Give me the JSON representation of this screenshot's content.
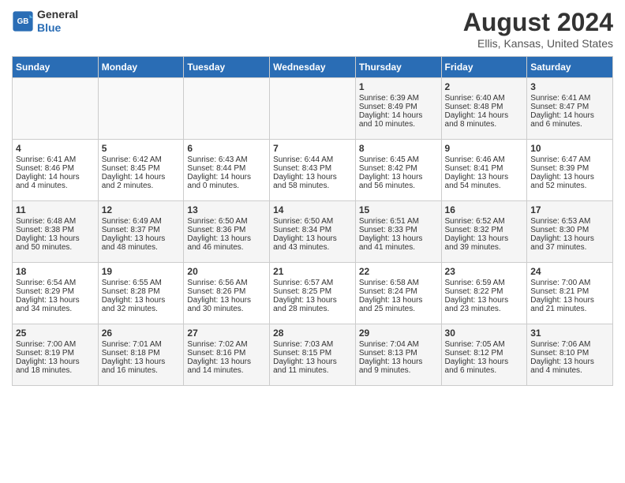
{
  "header": {
    "logo_line1": "General",
    "logo_line2": "Blue",
    "month": "August 2024",
    "location": "Ellis, Kansas, United States"
  },
  "days_of_week": [
    "Sunday",
    "Monday",
    "Tuesday",
    "Wednesday",
    "Thursday",
    "Friday",
    "Saturday"
  ],
  "weeks": [
    [
      {
        "day": "",
        "sunrise": "",
        "sunset": "",
        "daylight": ""
      },
      {
        "day": "",
        "sunrise": "",
        "sunset": "",
        "daylight": ""
      },
      {
        "day": "",
        "sunrise": "",
        "sunset": "",
        "daylight": ""
      },
      {
        "day": "",
        "sunrise": "",
        "sunset": "",
        "daylight": ""
      },
      {
        "day": "1",
        "sunrise": "Sunrise: 6:39 AM",
        "sunset": "Sunset: 8:49 PM",
        "daylight": "Daylight: 14 hours and 10 minutes."
      },
      {
        "day": "2",
        "sunrise": "Sunrise: 6:40 AM",
        "sunset": "Sunset: 8:48 PM",
        "daylight": "Daylight: 14 hours and 8 minutes."
      },
      {
        "day": "3",
        "sunrise": "Sunrise: 6:41 AM",
        "sunset": "Sunset: 8:47 PM",
        "daylight": "Daylight: 14 hours and 6 minutes."
      }
    ],
    [
      {
        "day": "4",
        "sunrise": "Sunrise: 6:41 AM",
        "sunset": "Sunset: 8:46 PM",
        "daylight": "Daylight: 14 hours and 4 minutes."
      },
      {
        "day": "5",
        "sunrise": "Sunrise: 6:42 AM",
        "sunset": "Sunset: 8:45 PM",
        "daylight": "Daylight: 14 hours and 2 minutes."
      },
      {
        "day": "6",
        "sunrise": "Sunrise: 6:43 AM",
        "sunset": "Sunset: 8:44 PM",
        "daylight": "Daylight: 14 hours and 0 minutes."
      },
      {
        "day": "7",
        "sunrise": "Sunrise: 6:44 AM",
        "sunset": "Sunset: 8:43 PM",
        "daylight": "Daylight: 13 hours and 58 minutes."
      },
      {
        "day": "8",
        "sunrise": "Sunrise: 6:45 AM",
        "sunset": "Sunset: 8:42 PM",
        "daylight": "Daylight: 13 hours and 56 minutes."
      },
      {
        "day": "9",
        "sunrise": "Sunrise: 6:46 AM",
        "sunset": "Sunset: 8:41 PM",
        "daylight": "Daylight: 13 hours and 54 minutes."
      },
      {
        "day": "10",
        "sunrise": "Sunrise: 6:47 AM",
        "sunset": "Sunset: 8:39 PM",
        "daylight": "Daylight: 13 hours and 52 minutes."
      }
    ],
    [
      {
        "day": "11",
        "sunrise": "Sunrise: 6:48 AM",
        "sunset": "Sunset: 8:38 PM",
        "daylight": "Daylight: 13 hours and 50 minutes."
      },
      {
        "day": "12",
        "sunrise": "Sunrise: 6:49 AM",
        "sunset": "Sunset: 8:37 PM",
        "daylight": "Daylight: 13 hours and 48 minutes."
      },
      {
        "day": "13",
        "sunrise": "Sunrise: 6:50 AM",
        "sunset": "Sunset: 8:36 PM",
        "daylight": "Daylight: 13 hours and 46 minutes."
      },
      {
        "day": "14",
        "sunrise": "Sunrise: 6:50 AM",
        "sunset": "Sunset: 8:34 PM",
        "daylight": "Daylight: 13 hours and 43 minutes."
      },
      {
        "day": "15",
        "sunrise": "Sunrise: 6:51 AM",
        "sunset": "Sunset: 8:33 PM",
        "daylight": "Daylight: 13 hours and 41 minutes."
      },
      {
        "day": "16",
        "sunrise": "Sunrise: 6:52 AM",
        "sunset": "Sunset: 8:32 PM",
        "daylight": "Daylight: 13 hours and 39 minutes."
      },
      {
        "day": "17",
        "sunrise": "Sunrise: 6:53 AM",
        "sunset": "Sunset: 8:30 PM",
        "daylight": "Daylight: 13 hours and 37 minutes."
      }
    ],
    [
      {
        "day": "18",
        "sunrise": "Sunrise: 6:54 AM",
        "sunset": "Sunset: 8:29 PM",
        "daylight": "Daylight: 13 hours and 34 minutes."
      },
      {
        "day": "19",
        "sunrise": "Sunrise: 6:55 AM",
        "sunset": "Sunset: 8:28 PM",
        "daylight": "Daylight: 13 hours and 32 minutes."
      },
      {
        "day": "20",
        "sunrise": "Sunrise: 6:56 AM",
        "sunset": "Sunset: 8:26 PM",
        "daylight": "Daylight: 13 hours and 30 minutes."
      },
      {
        "day": "21",
        "sunrise": "Sunrise: 6:57 AM",
        "sunset": "Sunset: 8:25 PM",
        "daylight": "Daylight: 13 hours and 28 minutes."
      },
      {
        "day": "22",
        "sunrise": "Sunrise: 6:58 AM",
        "sunset": "Sunset: 8:24 PM",
        "daylight": "Daylight: 13 hours and 25 minutes."
      },
      {
        "day": "23",
        "sunrise": "Sunrise: 6:59 AM",
        "sunset": "Sunset: 8:22 PM",
        "daylight": "Daylight: 13 hours and 23 minutes."
      },
      {
        "day": "24",
        "sunrise": "Sunrise: 7:00 AM",
        "sunset": "Sunset: 8:21 PM",
        "daylight": "Daylight: 13 hours and 21 minutes."
      }
    ],
    [
      {
        "day": "25",
        "sunrise": "Sunrise: 7:00 AM",
        "sunset": "Sunset: 8:19 PM",
        "daylight": "Daylight: 13 hours and 18 minutes."
      },
      {
        "day": "26",
        "sunrise": "Sunrise: 7:01 AM",
        "sunset": "Sunset: 8:18 PM",
        "daylight": "Daylight: 13 hours and 16 minutes."
      },
      {
        "day": "27",
        "sunrise": "Sunrise: 7:02 AM",
        "sunset": "Sunset: 8:16 PM",
        "daylight": "Daylight: 13 hours and 14 minutes."
      },
      {
        "day": "28",
        "sunrise": "Sunrise: 7:03 AM",
        "sunset": "Sunset: 8:15 PM",
        "daylight": "Daylight: 13 hours and 11 minutes."
      },
      {
        "day": "29",
        "sunrise": "Sunrise: 7:04 AM",
        "sunset": "Sunset: 8:13 PM",
        "daylight": "Daylight: 13 hours and 9 minutes."
      },
      {
        "day": "30",
        "sunrise": "Sunrise: 7:05 AM",
        "sunset": "Sunset: 8:12 PM",
        "daylight": "Daylight: 13 hours and 6 minutes."
      },
      {
        "day": "31",
        "sunrise": "Sunrise: 7:06 AM",
        "sunset": "Sunset: 8:10 PM",
        "daylight": "Daylight: 13 hours and 4 minutes."
      }
    ]
  ]
}
